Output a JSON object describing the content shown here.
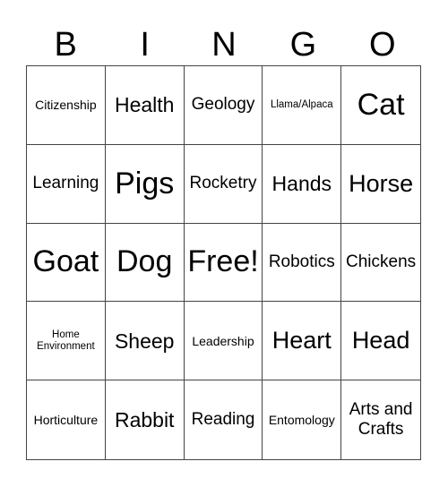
{
  "header": [
    "B",
    "I",
    "N",
    "G",
    "O"
  ],
  "cells": [
    {
      "text": "Citizenship",
      "size": "s-sm"
    },
    {
      "text": "Health",
      "size": "s-xl"
    },
    {
      "text": "Geology",
      "size": "s-lg"
    },
    {
      "text": "Llama/Alpaca",
      "size": "s-xs"
    },
    {
      "text": "Cat",
      "size": "s-xxxl"
    },
    {
      "text": "Learning",
      "size": "s-lg"
    },
    {
      "text": "Pigs",
      "size": "s-xxxl"
    },
    {
      "text": "Rocketry",
      "size": "s-lg"
    },
    {
      "text": "Hands",
      "size": "s-xl"
    },
    {
      "text": "Horse",
      "size": "s-xxl"
    },
    {
      "text": "Goat",
      "size": "s-xxxl"
    },
    {
      "text": "Dog",
      "size": "s-xxxl"
    },
    {
      "text": "Free!",
      "size": "s-xxxl"
    },
    {
      "text": "Robotics",
      "size": "s-lg"
    },
    {
      "text": "Chickens",
      "size": "s-lg"
    },
    {
      "text": "Home Environment",
      "size": "s-xs"
    },
    {
      "text": "Sheep",
      "size": "s-xl"
    },
    {
      "text": "Leadership",
      "size": "s-sm"
    },
    {
      "text": "Heart",
      "size": "s-xxl"
    },
    {
      "text": "Head",
      "size": "s-xxl"
    },
    {
      "text": "Horticulture",
      "size": "s-sm"
    },
    {
      "text": "Rabbit",
      "size": "s-xl"
    },
    {
      "text": "Reading",
      "size": "s-lg"
    },
    {
      "text": "Entomology",
      "size": "s-sm"
    },
    {
      "text": "Arts and Crafts",
      "size": "s-lg"
    }
  ]
}
